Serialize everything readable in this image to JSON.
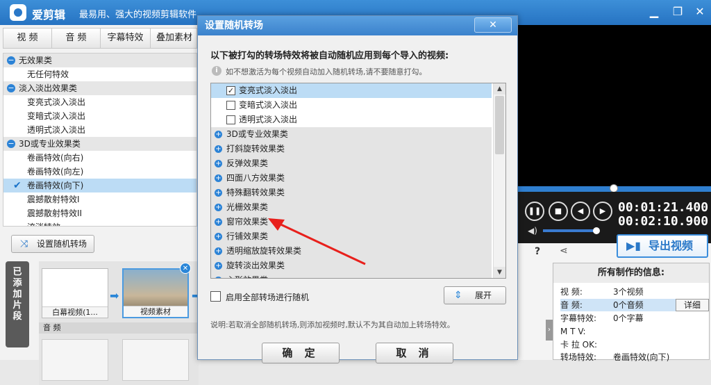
{
  "app": {
    "name": "爱剪辑",
    "slogan": "最易用、强大的视频剪辑软件"
  },
  "colors": {
    "brand": "#2a78c8",
    "accent": "#2c83d6",
    "annotation": "#e8201c"
  },
  "left_tabs": [
    "视 频",
    "音 频",
    "字幕特效",
    "叠加素材"
  ],
  "effects": [
    {
      "type": "cat",
      "label": "无效果类"
    },
    {
      "type": "item",
      "label": "无任何特效"
    },
    {
      "type": "cat",
      "label": "淡入淡出效果类"
    },
    {
      "type": "item",
      "label": "变亮式淡入淡出"
    },
    {
      "type": "item",
      "label": "变暗式淡入淡出"
    },
    {
      "type": "item",
      "label": "透明式淡入淡出"
    },
    {
      "type": "cat",
      "label": "3D或专业效果类"
    },
    {
      "type": "item",
      "label": "卷画特效(向右)"
    },
    {
      "type": "item",
      "label": "卷画特效(向左)"
    },
    {
      "type": "item",
      "label": "卷画特效(向下)",
      "selected": true
    },
    {
      "type": "item",
      "label": "震撼散射特效I"
    },
    {
      "type": "item",
      "label": "震撼散射特效II"
    },
    {
      "type": "item",
      "label": "流淌特效"
    }
  ],
  "random_button": "设置随机转场",
  "added_tab": "已添加片段",
  "clips": [
    {
      "label": "白幕视频(1..."
    },
    {
      "label": "视频素材"
    }
  ],
  "audio_label": "音 频",
  "player": {
    "current_time": "00:01:21.400",
    "total_time": "00:02:10.900",
    "progress": 0.49,
    "volume": 0.92
  },
  "export_button": "导出视频",
  "info": {
    "title": "所有制作的信息:",
    "rows": [
      {
        "label": "视    频:",
        "value": "3个视频"
      },
      {
        "label": "音    频:",
        "value": "0个音频"
      },
      {
        "label": "字幕特效:",
        "value": "0个字幕"
      },
      {
        "label": "M  T  V:",
        "value": ""
      },
      {
        "label": "卡 拉 OK:",
        "value": ""
      },
      {
        "label": "转场特效:",
        "value": "卷画特效(向下)"
      }
    ],
    "detail_button": "详细"
  },
  "dialog": {
    "title": "设置随机转场",
    "close": "✕",
    "heading": "以下被打勾的转场特效将被自动随机应用到每个导入的视频:",
    "hint": "如不想激活为每个视频自动加入随机转场,请不要随意打勾。",
    "list": [
      {
        "type": "sub",
        "label": "变亮式淡入淡出",
        "checked": true
      },
      {
        "type": "sub",
        "label": "变暗式淡入淡出",
        "checked": false
      },
      {
        "type": "sub",
        "label": "透明式淡入淡出",
        "checked": false
      },
      {
        "type": "cat",
        "label": "3D或专业效果类"
      },
      {
        "type": "cat",
        "label": "打斜旋转效果类"
      },
      {
        "type": "cat",
        "label": "反弹效果类"
      },
      {
        "type": "cat",
        "label": "四面八方效果类"
      },
      {
        "type": "cat",
        "label": "特殊翻转效果类"
      },
      {
        "type": "cat",
        "label": "光栅效果类"
      },
      {
        "type": "cat",
        "label": "窗帘效果类"
      },
      {
        "type": "cat",
        "label": "行铺效果类"
      },
      {
        "type": "cat",
        "label": "透明缩放旋转效果类"
      },
      {
        "type": "cat",
        "label": "旋转淡出效果类"
      },
      {
        "type": "cat",
        "label": "心形效果类"
      }
    ],
    "enable_all": "启用全部转场进行随机",
    "expand": "展开",
    "note": "说明:若取消全部随机转场,则添加视频时,默认不为其自动加上转场特效。",
    "ok": "确 定",
    "cancel": "取 消"
  }
}
